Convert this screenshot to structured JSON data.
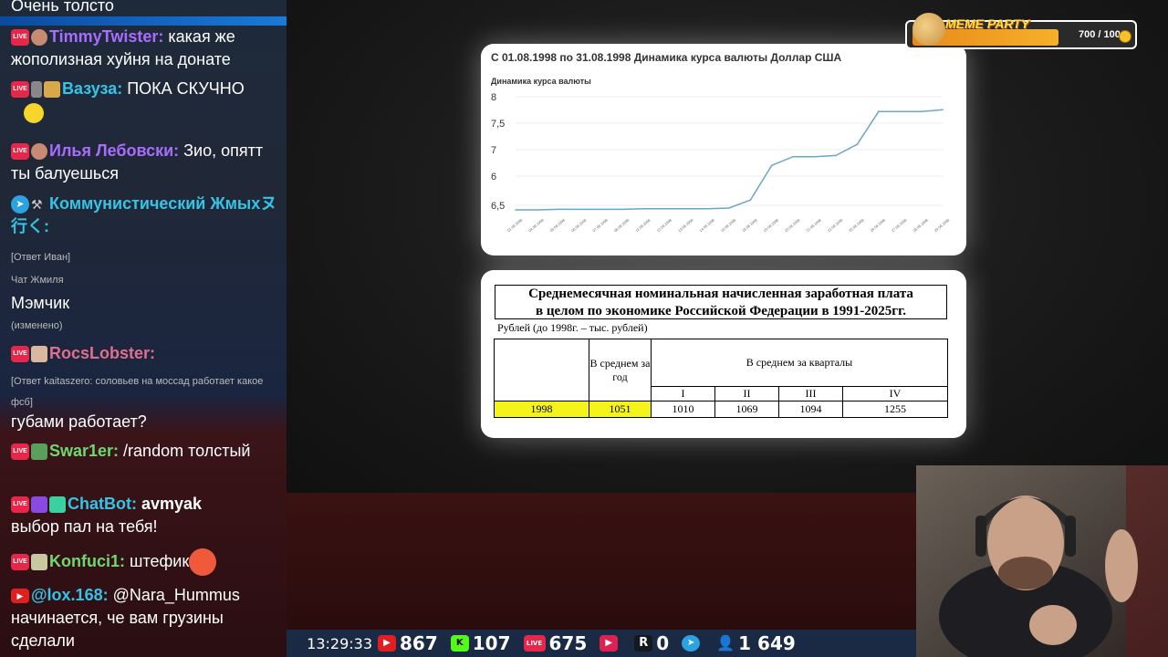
{
  "chat": {
    "messages": [
      {
        "id": "m0",
        "text": "Очень толсто"
      },
      {
        "id": "m1",
        "nick": "TimmyTwister:",
        "nick_color": "#a86cff",
        "text": " какая же жополизная хуйня на донате"
      },
      {
        "id": "m2",
        "nick": "Вазуза:",
        "nick_color": "#33c4e6",
        "text": " ПОКА СКУЧНО"
      },
      {
        "id": "m3",
        "nick": "Илья Лебовски:",
        "nick_color": "#a86cff",
        "text": " Зио, опятт ты балуешься"
      },
      {
        "id": "m4",
        "nick": "Коммунистический Жмыхヌ行く:",
        "nick_color": "#33c4e6",
        "text": ""
      },
      {
        "id": "m4-meta1",
        "text": "[Ответ Иван]"
      },
      {
        "id": "m4-meta2",
        "text": "Чат Жмиля"
      },
      {
        "id": "m4-body",
        "text": "Мэмчик"
      },
      {
        "id": "m4-edited",
        "text": "(изменено)"
      },
      {
        "id": "m5",
        "nick": "RocsLobster:",
        "nick_color": "#e06f8b",
        "text": ""
      },
      {
        "id": "m5-meta",
        "text": "[Ответ kaitaszero: соловьев на моссад работает какое фсб]"
      },
      {
        "id": "m5-body",
        "text": "губами работает?"
      },
      {
        "id": "m6",
        "nick": "Swar1er:",
        "nick_color": "#6fd86f",
        "text": " /random толстый"
      },
      {
        "id": "m7",
        "nick": "ChatBot:",
        "nick_color": "#33c4e6",
        "text": " avmyak",
        "body": "выбор пал на тебя!"
      },
      {
        "id": "m8",
        "nick": "Konfuci1:",
        "nick_color": "#6fd86f",
        "text": " штефик"
      },
      {
        "id": "m9",
        "nick": "@lox.168:",
        "nick_color": "#33c4e6",
        "text": " @Nara_Hummus начинается, че вам грузины сделали"
      }
    ]
  },
  "chart": {
    "title": "С 01.08.1998 по 31.08.1998 Динамика курса валюты Доллар США",
    "subtitle": "Динамика курса валюты"
  },
  "chart_data": {
    "type": "line",
    "title": "С 01.08.1998 по 31.08.1998 Динамика курса валюты Доллар США",
    "ylabel": "",
    "yticks": [
      "8",
      "7,5",
      "7",
      "6",
      "6,5"
    ],
    "ylim": [
      6.3,
      8.1
    ],
    "x": [
      "01.08.1998",
      "04.08.1998",
      "05.08.1998",
      "06.08.1998",
      "07.08.1998",
      "08.08.1998",
      "11.08.1998",
      "12.08.1998",
      "13.08.1998",
      "14.08.1998",
      "15.08.1998",
      "18.08.1998",
      "19.08.1998",
      "20.08.1998",
      "21.08.1998",
      "22.08.1998",
      "25.08.1998",
      "26.08.1998",
      "27.08.1998",
      "28.08.1998",
      "29.08.1998"
    ],
    "series": [
      {
        "values": [
          6.27,
          6.27,
          6.28,
          6.28,
          6.28,
          6.28,
          6.29,
          6.29,
          6.29,
          6.29,
          6.3,
          6.43,
          6.99,
          7.13,
          7.13,
          7.15,
          7.33,
          7.86,
          7.86,
          7.86,
          7.89
        ]
      }
    ],
    "color": "#6aa6c8"
  },
  "salary_table": {
    "title_line1": "Среднемесячная номинальная начисленная заработная плата",
    "title_line2": "в целом по экономике Российской Федерации в 1991-2025гг.",
    "note": "Рублей (до 1998г. – тыс. рублей)",
    "col_avg_year": "В среднем за год",
    "col_quarters": "В среднем за кварталы",
    "quarters": [
      "I",
      "II",
      "III",
      "IV"
    ],
    "row": {
      "year": "1998",
      "avg": "1051",
      "q": [
        "1010",
        "1069",
        "1094",
        "1255"
      ]
    }
  },
  "meme_party": {
    "label": "MEME PARTY",
    "count": "700 / 1000",
    "progress": 0.7
  },
  "statbar": {
    "time": "13:29:33",
    "youtube": "867",
    "kick": "107",
    "vk": "675",
    "rutube": "0",
    "telegram": "",
    "viewers": "1 649"
  }
}
